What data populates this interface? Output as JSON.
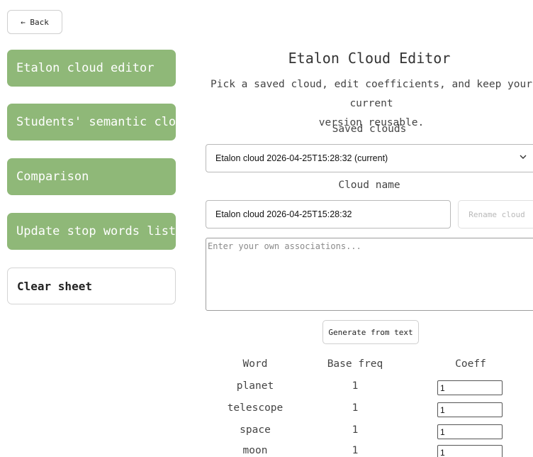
{
  "back_label": "← Back",
  "nav": {
    "etalon_editor": "Etalon cloud editor",
    "students_cloud": "Students' semantic cloud",
    "comparison": "Comparison",
    "stop_words": "Update stop words list",
    "clear_sheet": "Clear sheet"
  },
  "main": {
    "title": "Etalon Cloud Editor",
    "subtitle_line1": "Pick a saved cloud, edit coefficients, and keep your current",
    "subtitle_line2": "version reusable.",
    "saved_clouds_label": "Saved clouds",
    "saved_clouds_selected": "Etalon cloud 2026-04-25T15:28:32 (current)",
    "cloud_name_label": "Cloud name",
    "cloud_name_value": "Etalon cloud 2026-04-25T15:28:32",
    "rename_label": "Rename cloud",
    "associations_placeholder": "Enter your own associations...",
    "generate_label": "Generate from text"
  },
  "table": {
    "headers": {
      "word": "Word",
      "base_freq": "Base freq",
      "coeff": "Coeff"
    },
    "rows": [
      {
        "word": "planet",
        "base_freq": "1",
        "coeff": "1"
      },
      {
        "word": "telescope",
        "base_freq": "1",
        "coeff": "1"
      },
      {
        "word": "space",
        "base_freq": "1",
        "coeff": "1"
      },
      {
        "word": "moon",
        "base_freq": "1",
        "coeff": "1"
      }
    ]
  },
  "colors": {
    "nav_green": "#8fb878"
  }
}
